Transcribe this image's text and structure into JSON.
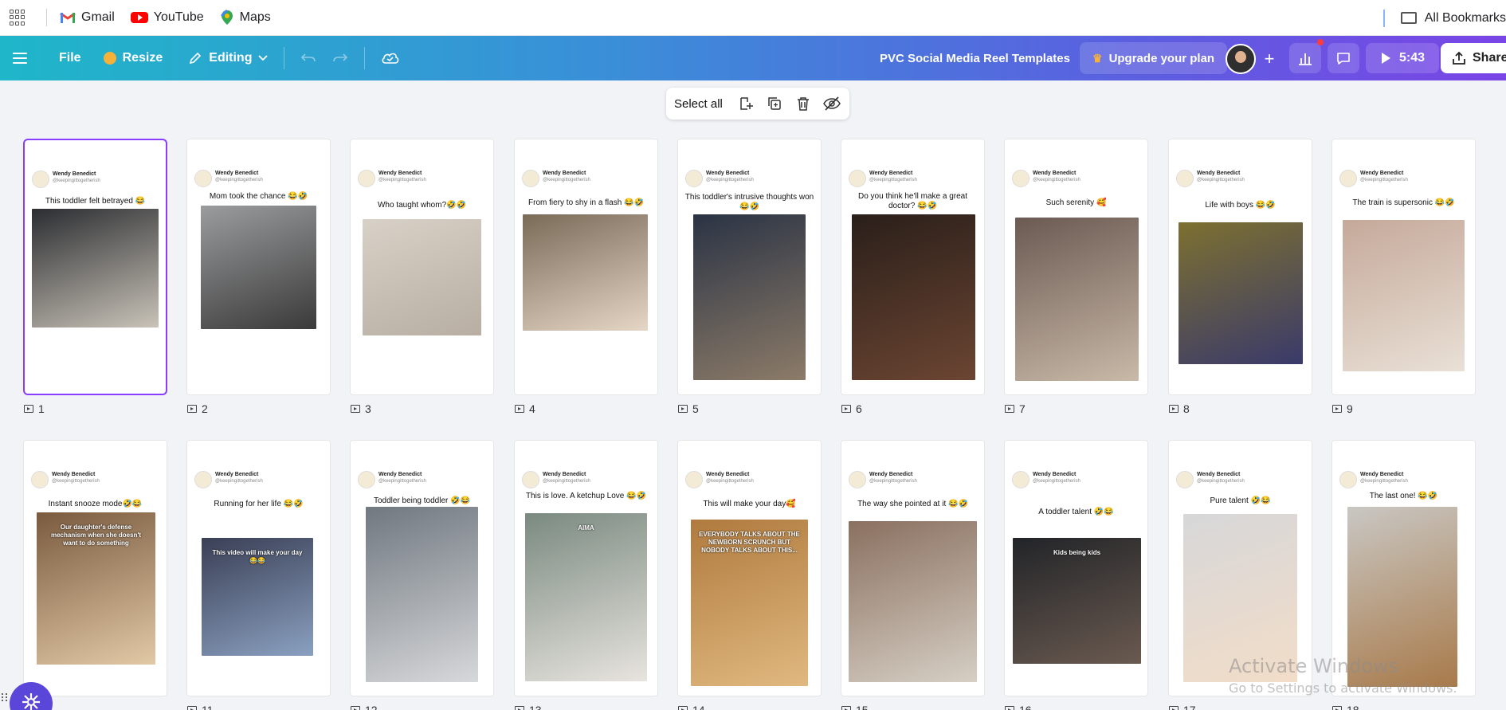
{
  "bookmarks": {
    "items": [
      {
        "label": "Gmail",
        "icon": "gmail-icon",
        "color": "#ea4335"
      },
      {
        "label": "YouTube",
        "icon": "youtube-icon",
        "color": "#ff0000"
      },
      {
        "label": "Maps",
        "icon": "maps-icon",
        "color": "#34a853"
      }
    ],
    "all_bookmarks": "All Bookmarks"
  },
  "toolbar": {
    "file": "File",
    "resize": "Resize",
    "editing": "Editing",
    "doc_title": "PVC Social Media Reel Templates",
    "upgrade": "Upgrade your plan",
    "duration": "5:43",
    "share": "Share"
  },
  "selection_bar": {
    "select_all": "Select all"
  },
  "brand": {
    "accent": "#8b3dff",
    "gradient_start": "#1fb6c9",
    "gradient_end": "#7a45e6"
  },
  "pages": [
    {
      "num": "1",
      "author": "Wendy Benedict",
      "handle": "@keepingittogetherish",
      "caption": "This toddler felt betrayed 😂",
      "selected": true
    },
    {
      "num": "2",
      "author": "Wendy Benedict",
      "handle": "@keepingittogetherish",
      "caption": "Mom took the chance 😂🤣"
    },
    {
      "num": "3",
      "author": "Wendy Benedict",
      "handle": "@keepingittogetherish",
      "caption": "Who taught whom?🤣🤣"
    },
    {
      "num": "4",
      "author": "Wendy Benedict",
      "handle": "@keepingittogetherish",
      "caption": "From fiery to shy in a flash 😂🤣"
    },
    {
      "num": "5",
      "author": "Wendy Benedict",
      "handle": "@keepingittogetherish",
      "caption": "This toddler's intrusive thoughts won 😂🤣"
    },
    {
      "num": "6",
      "author": "Wendy Benedict",
      "handle": "@keepingittogetherish",
      "caption": "Do you think he'll make a great doctor? 😂🤣"
    },
    {
      "num": "7",
      "author": "Wendy Benedict",
      "handle": "@keepingittogetherish",
      "caption": "Such serenity 🥰"
    },
    {
      "num": "8",
      "author": "Wendy Benedict",
      "handle": "@keepingittogetherish",
      "caption": "Life with boys 😂🤣"
    },
    {
      "num": "9",
      "author": "Wendy Benedict",
      "handle": "@keepingittogetherish",
      "caption": "The train is supersonic 😂🤣"
    },
    {
      "num": "10",
      "author": "Wendy Benedict",
      "handle": "@keepingittogetherish",
      "caption": "Instant snooze mode🤣😂",
      "overlay": "Our daughter's defense mechanism when she doesn't want to do something"
    },
    {
      "num": "11",
      "author": "Wendy Benedict",
      "handle": "@keepingittogetherish",
      "caption": "Running for her life 😂🤣",
      "overlay": "This video will make your day 😂😂"
    },
    {
      "num": "12",
      "author": "Wendy Benedict",
      "handle": "@keepingittogetherish",
      "caption": "Toddler being toddler 🤣😂"
    },
    {
      "num": "13",
      "author": "Wendy Benedict",
      "handle": "@keepingittogetherish",
      "caption": "This is love. A ketchup Love 😂🤣",
      "overlay": "AIMA"
    },
    {
      "num": "14",
      "author": "Wendy Benedict",
      "handle": "@keepingittogetherish",
      "caption": "This will make your day🥰",
      "overlay": "EVERYBODY TALKS ABOUT THE NEWBORN SCRUNCH BUT NOBODY TALKS ABOUT THIS..."
    },
    {
      "num": "15",
      "author": "Wendy Benedict",
      "handle": "@keepingittogetherish",
      "caption": "The way she pointed at it 😂🤣"
    },
    {
      "num": "16",
      "author": "Wendy Benedict",
      "handle": "@keepingittogetherish",
      "caption": "A toddler talent 🤣😂",
      "overlay": "Kids being kids"
    },
    {
      "num": "17",
      "author": "Wendy Benedict",
      "handle": "@keepingittogetherish",
      "caption": "Pure talent 🤣😂"
    },
    {
      "num": "18",
      "author": "Wendy Benedict",
      "handle": "@keepingittogetherish",
      "caption": "The last one! 😂🤣"
    }
  ],
  "watermark": {
    "line1": "Activate Windows",
    "line2": "Go to Settings to activate Windows."
  }
}
